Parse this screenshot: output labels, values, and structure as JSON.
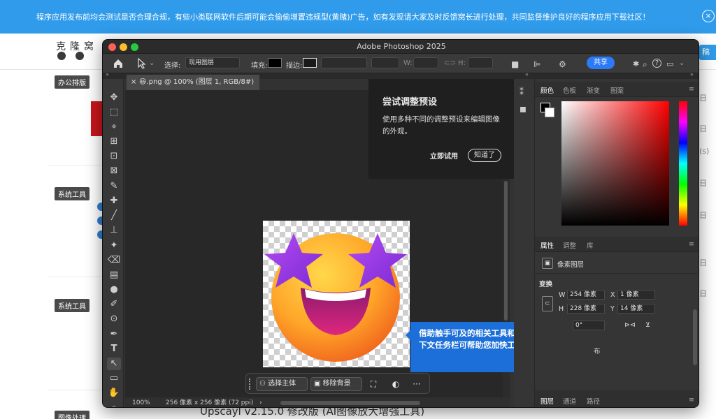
{
  "notice": {
    "text": "程序应用发布前均会测试是否合理合规，有些小类联网软件后期可能会偷偷增置违规型(黄赌)广告，如有发现请大家及时反馈窝长进行处理，共同监督维护良好的程序应用下载社区！",
    "close": "×"
  },
  "site": {
    "logo": "克隆窝",
    "nav_button": "稿",
    "categories": [
      "办公排版",
      "系统工具",
      "系统工具",
      "图像处理"
    ],
    "right_meta": [
      "日",
      "日",
      "(s)",
      "日",
      "日",
      "日",
      "日"
    ],
    "bottom_title": "Upscayl v2.15.0 修改版 (AI图像放大增强工具)"
  },
  "photoshop": {
    "title": "Adobe Photoshop 2025",
    "options": {
      "select_label": "选择:",
      "select_value": "现用图层",
      "fill_label": "填充:",
      "stroke_label": "描边:",
      "w_label": "W:",
      "h_label": "H:",
      "share": "共享",
      "help": "?"
    },
    "doc_tab": {
      "close": "×",
      "name": "😃.png @ 100% (图层 1, RGB/8#)"
    },
    "tools": [
      "✥",
      "⬚",
      "⌖",
      "⊞",
      "⊡",
      "⊠",
      "✎",
      "✚",
      "╱",
      "⊥",
      "✦",
      "⌫",
      "▤",
      "●",
      "✐",
      "⊙",
      "✒",
      "T",
      "↖",
      "▭",
      "✋",
      "⌕"
    ],
    "status": {
      "zoom": "100%",
      "info": "256 像素 x 256 像素 (72 ppi)",
      "arrow": "›"
    },
    "context_bar": {
      "select_subject": "选择主体",
      "remove_bg": "移除背景",
      "more": "···"
    },
    "popover": {
      "title": "尝试调整预设",
      "body": "使用多种不同的调整预设来编辑图像的外观。",
      "try": "立即试用",
      "ok": "知道了"
    },
    "tip": "借助触手可及的相关工具和操作，新的上下文任务栏可帮助您加快工作流程。",
    "color_tabs": [
      "颜色",
      "色板",
      "渐变",
      "图案"
    ],
    "props_tabs": [
      "属性",
      "调整",
      "库"
    ],
    "props": {
      "layer_type": "像素图层",
      "transform": "变换",
      "w_label": "W",
      "w_value": "254 像素",
      "h_label": "H",
      "h_value": "228 像素",
      "x_label": "X",
      "x_value": "1 像素",
      "y_label": "Y",
      "y_value": "14 像素",
      "angle": "0°",
      "extra": "布"
    },
    "layers_tabs": [
      "图层",
      "通道",
      "路径"
    ]
  },
  "colors": {
    "accent": "#2c7af7",
    "tip_blue": "#1c6fd8",
    "notice_blue": "#2f9bea"
  }
}
